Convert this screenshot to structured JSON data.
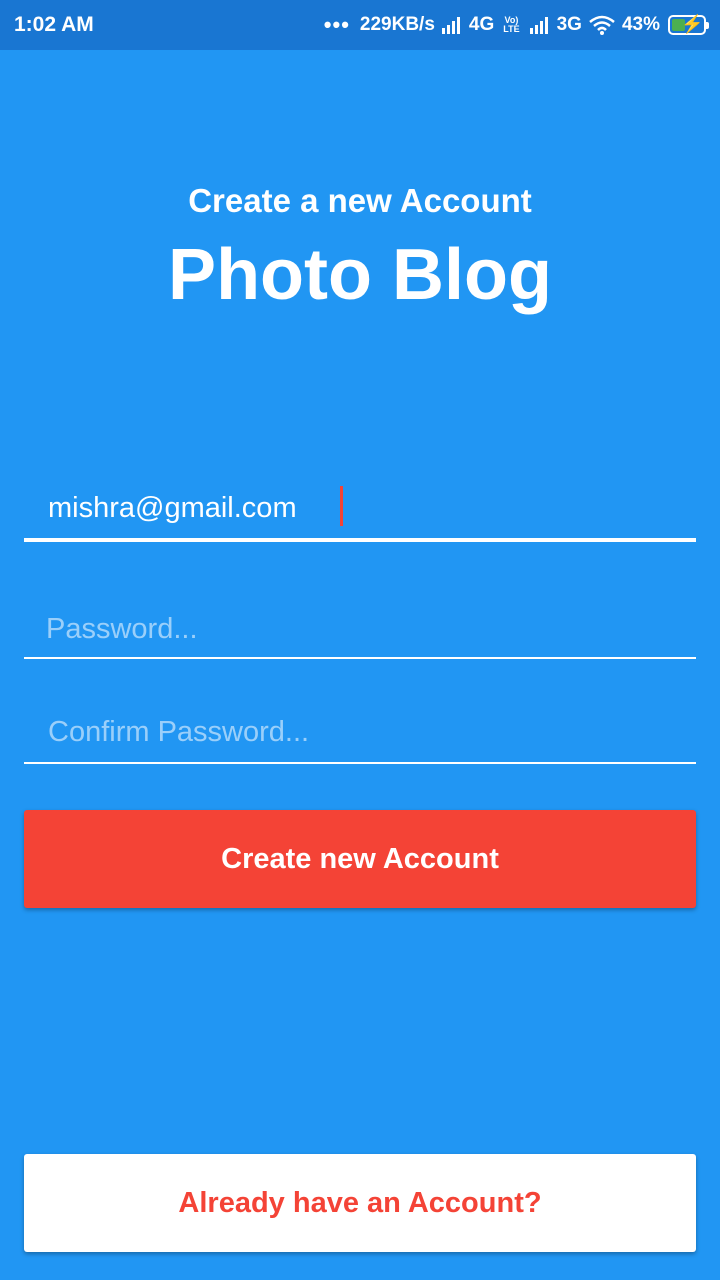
{
  "status_bar": {
    "time": "1:02 AM",
    "dots": "•••",
    "speed": "229KB/s",
    "network_4g": "4G",
    "volte_top": "Vo)",
    "volte_bottom": "LTE",
    "network_3g": "3G",
    "battery": "43%"
  },
  "header": {
    "subtitle": "Create a new Account",
    "title": "Photo Blog"
  },
  "form": {
    "email_value": "mishra@gmail.com",
    "password_placeholder": "Password...",
    "confirm_placeholder": "Confirm Password..."
  },
  "buttons": {
    "create_label": "Create new Account",
    "login_label": "Already have an Account?"
  },
  "colors": {
    "background": "#2196F3",
    "status_bar": "#1976D2",
    "accent": "#F44336"
  }
}
